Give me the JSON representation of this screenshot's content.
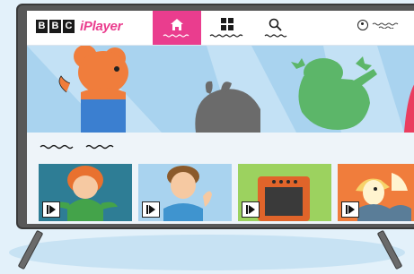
{
  "brand": {
    "bbc_letters": [
      "B",
      "B",
      "C"
    ],
    "service_name": "iPlayer"
  },
  "nav": {
    "tabs": [
      {
        "name": "home",
        "icon": "home-icon",
        "active": true
      },
      {
        "name": "categories",
        "icon": "grid-icon",
        "active": false
      },
      {
        "name": "search",
        "icon": "search-icon",
        "active": false
      }
    ]
  },
  "account": {
    "icon": "user-icon"
  },
  "shelf": {
    "tiles": [
      {
        "character": "red-haired-boy",
        "icon": "play-icon"
      },
      {
        "character": "brown-haired-child",
        "icon": "play-icon"
      },
      {
        "character": "oven",
        "icon": "play-icon"
      },
      {
        "character": "duck-character",
        "icon": "play-icon"
      }
    ]
  },
  "colors": {
    "brand_pink": "#ea3d8e",
    "hero_sky": "#a9d3ef",
    "bear_orange": "#f07d3c",
    "bird_gray": "#6b6b6b",
    "frog_green": "#5cb669",
    "tile_teal": "#2e7d95",
    "tile_lightblue": "#a9d3ef",
    "tile_green": "#9cd25f",
    "tile_orange": "#f07d3c"
  }
}
